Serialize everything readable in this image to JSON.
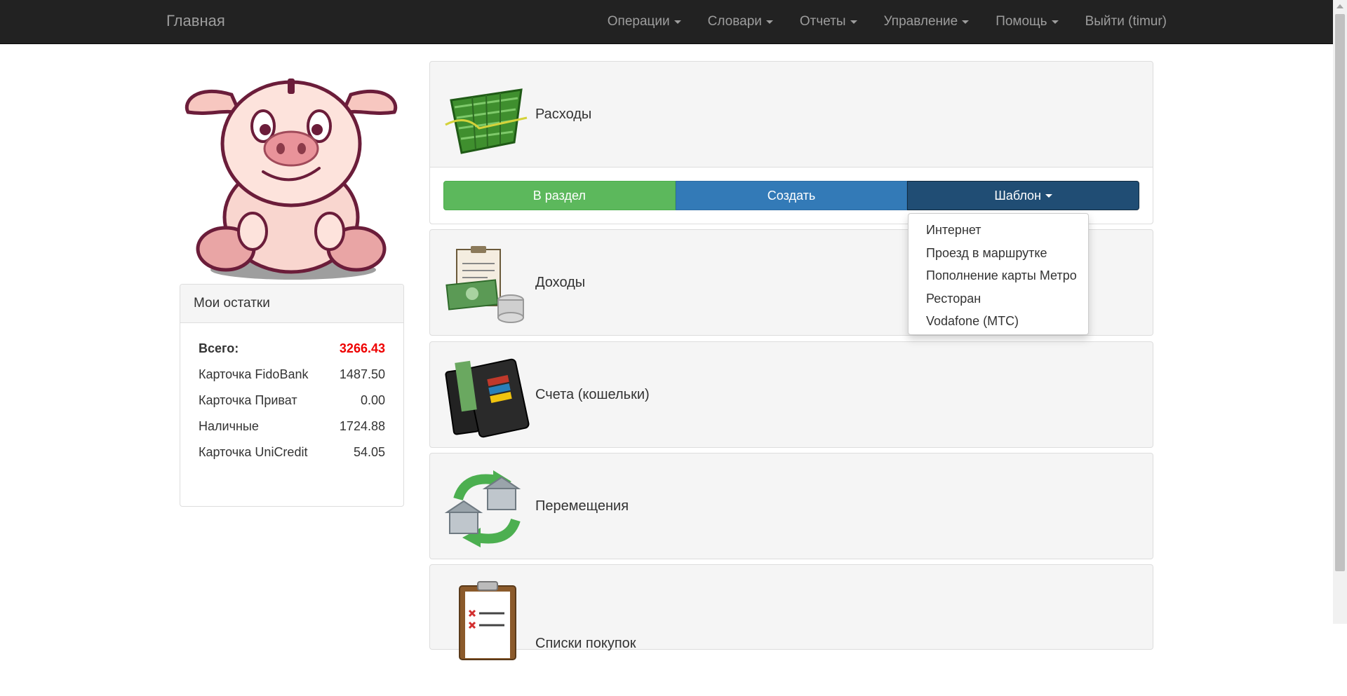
{
  "navbar": {
    "brand": "Главная",
    "items": [
      {
        "label": "Операции",
        "dropdown": true
      },
      {
        "label": "Словари",
        "dropdown": true
      },
      {
        "label": "Отчеты",
        "dropdown": true
      },
      {
        "label": "Управление",
        "dropdown": true
      },
      {
        "label": "Помощь",
        "dropdown": true
      },
      {
        "label": "Выйти (timur)",
        "dropdown": false
      }
    ]
  },
  "balances": {
    "title": "Мои остатки",
    "total_label": "Всего:",
    "total_value": "3266.43",
    "rows": [
      {
        "label": "Карточка FidoBank",
        "value": "1487.50"
      },
      {
        "label": "Карточка Приват",
        "value": "0.00"
      },
      {
        "label": "Наличные",
        "value": "1724.88"
      },
      {
        "label": "Карточка UniCredit",
        "value": "54.05"
      }
    ]
  },
  "panels": [
    {
      "title": "Расходы",
      "icon": "basket-icon"
    },
    {
      "title": "Доходы",
      "icon": "income-icon"
    },
    {
      "title": "Счета (кошельки)",
      "icon": "wallet-icon"
    },
    {
      "title": "Перемещения",
      "icon": "transfer-icon"
    },
    {
      "title": "Списки покупок",
      "icon": "checklist-icon"
    }
  ],
  "expenses_actions": {
    "to_section": "В раздел",
    "create": "Создать",
    "template": "Шаблон"
  },
  "template_menu": [
    "Интернет",
    "Проезд в маршрутке",
    "Пополнение карты Метро",
    "Ресторан",
    "Vodafone (МТС)"
  ],
  "colors": {
    "navbar_bg": "#222222",
    "total_value": "#ee0000",
    "btn_green": "#5cb85c",
    "btn_blue": "#337ab7",
    "btn_dark": "#204d74"
  }
}
